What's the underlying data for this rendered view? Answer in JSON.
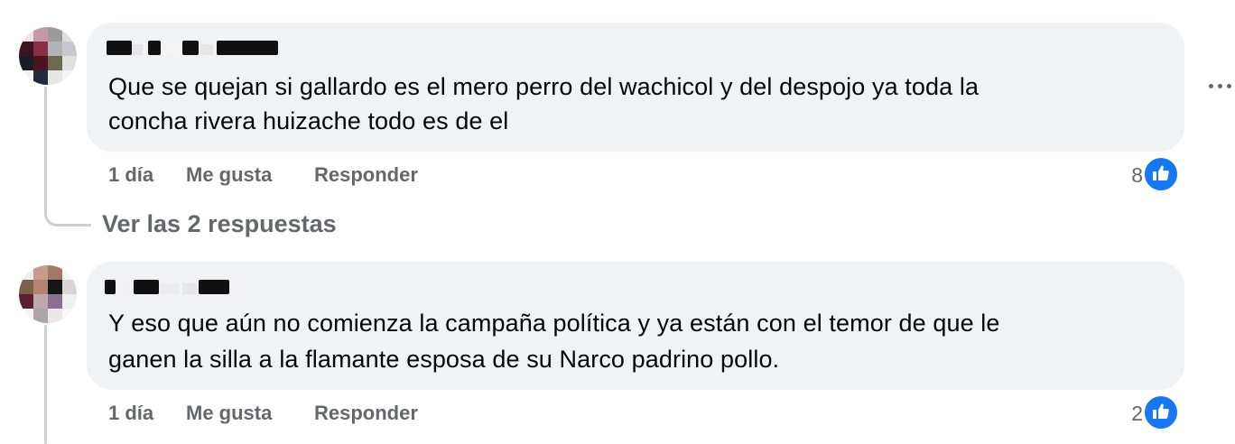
{
  "comments": [
    {
      "text_lines": [
        "Que se quejan si gallardo es el mero perro del wachicol y del despojo ya toda la",
        "concha rivera huizache todo es de el"
      ],
      "time": "1 día",
      "like_label": "Me gusta",
      "reply_label": "Responder",
      "reaction_count": "8",
      "reaction_icon": "like-icon",
      "replies_link": "Ver las 2 respuestas"
    },
    {
      "text_lines": [
        "Y eso que aún no comienza la campaña política y ya están con el temor de que le",
        "ganen la silla a la flamante esposa de su Narco padrino pollo."
      ],
      "time": "1 día",
      "like_label": "Me gusta",
      "reply_label": "Responder",
      "reaction_count": "2",
      "reaction_icon": "like-icon"
    }
  ],
  "colors": {
    "bubble": "#f0f2f5",
    "meta_text": "#65676b",
    "like_blue": "#1877f2",
    "thread_line": "#ccd0d5"
  }
}
